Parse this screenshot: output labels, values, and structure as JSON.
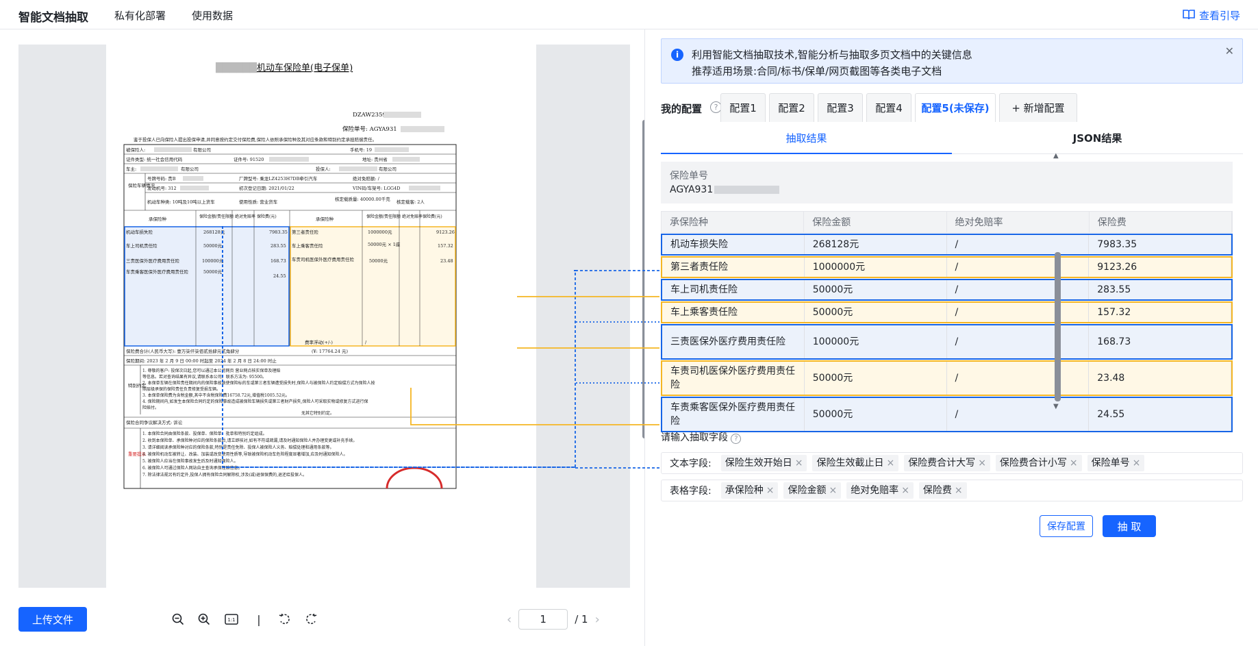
{
  "header": {
    "brand": "智能文档抽取",
    "nav": [
      "私有化部署",
      "使用数据"
    ],
    "guide": "查看引导"
  },
  "document": {
    "title": "机动车保险单(电子保单)",
    "policy_code": "DZAW2359",
    "policy_no": "保险单号: AGYA931",
    "notice_line": "鉴于投保人已向保险人提出投保申请,并同意按约定交付保险费,保险人依照承保险种及其对应条款和特别约定承担赔偿责任。",
    "insured": "被保险人:",
    "insured_suffix": "有限公司",
    "phone": "手机号: 19",
    "id_type": "证件类型: 统一社会信用代码",
    "id_no": "证件号: 91520",
    "addr": "地址: 贵州省",
    "owner": "车主:",
    "owner_suffix": "有限公司",
    "applicant": "投保人:",
    "applicant_suffix": "有限公司",
    "veh_label": "保险车辆情况",
    "plate": "号牌号码: 贵B",
    "model": "厂牌型号: 乘龙LZ4253H7DB牵引汽车",
    "deduct": "绝对免赔额: /",
    "engine": "发动机号: 312",
    "reg_date": "初次登记日期: 2021/01/22",
    "vin": "VIN码/车架号: LGG4D",
    "vtype": "机动车种类: 10吨及10吨以上货车",
    "use": "使用性质: 营业货车",
    "load": "核定载质量: 40000.00千克",
    "seats": "核定载客: 2人",
    "cols": [
      "承保险种",
      "保险金额/责任限额",
      "绝对免赔率",
      "保险费(元)"
    ],
    "left_items": [
      [
        "机动车损失险",
        "268128元",
        "7983.35"
      ],
      [
        "车上司机责任险",
        "50000元",
        "283.55"
      ],
      [
        "三责医保外医疗费用责任险",
        "100000元",
        "168.73"
      ],
      [
        "车责乘客医保外医疗费用责任险",
        "50000元",
        "24.55"
      ]
    ],
    "right_items": [
      [
        "第三者责任险",
        "1000000元",
        "9123.26"
      ],
      [
        "车上乘客责任险",
        "50000元 × 1座",
        "157.32"
      ],
      [
        "车责司机医保外医疗费用责任险",
        "50000元",
        "23.48"
      ]
    ],
    "float_row": "费率浮动(+/-)",
    "float_val": "/",
    "total": "保险费合计(人民币大写): 壹万柒仟柒佰贰拾肆元贰角肆分",
    "total_num": "(¥: 17764.24 元)",
    "period": "保险期间: 2023 年 2 月 9 日 00:00 时起至 2024 年 2 月 8 日 24:00 时止",
    "special_label": "特别约定",
    "special": [
      "1. 尊敬的客户: 投保次日起,您可以通过本公司网页                    营业网点核实保单及理赔",
      "等信息。若对查询结果有异议,请联系本公司。联系方法为: 95500。",
      "2. 本保单车辆在保险责任期间内的保险事故致使保险标的车或第三者车辆遭受损失时,保险人与被保险人约定赔偿方式为保险人按",
      "照层级承保的保险责任负责修复受损车辆。",
      "3. 本保单保险费为含税金额,其中不含税保险费16758.72元,增值税1005.52元。",
      "4. 保险期间内,如发生本保险合同约定的保险事故造成被保险车辆损失或第三者财产损失,保险人可采取实物或修复方式进行保",
      "险赔付。"
    ],
    "special_end": "无其它特别约定。",
    "dispute": "保险合同争议解决方式: 诉讼",
    "tips_label": "重要提示",
    "tips": [
      "1. 本保险合同由保险条款、投保单、保险单、批单和特别约定组成。",
      "2. 收到本保险单、承保险种对应的保险条款后,请立即核对,如有不符或疏漏,请及时通知保险人并办理变更或补充手续。",
      "3. 请详细阅读承保险种对应的保险条款,特别是责任免除、投保人被保险人义务、赔偿处理和通用条款等。",
      "4. 被保险机动车被转让、改装、加装或改变使用性质等,导致被保险机动车危险程度显著增加,应及时通知保险人。",
      "5. 被保险人应当在保险事故发生后及时通知保险人。",
      "6. 被保险人可通过保险人网站自主查询承保理赔信息。",
      "7. 除法律法规另有约定外,投保人拥有保险合同解除权,涉及(减)退保保费的,退还给投保人。"
    ]
  },
  "toolbar": {
    "upload": "上传文件",
    "page_current": "1",
    "page_total": "/ 1",
    "sep": "|",
    "ratio": "1:1"
  },
  "notice": {
    "line1": "利用智能文档抽取技术,智能分析与抽取多页文档中的关键信息",
    "line2": "推荐适用场景:合同/标书/保单/网页截图等各类电子文档"
  },
  "config": {
    "label": "我的配置",
    "tabs": [
      "配置1",
      "配置2",
      "配置3",
      "配置4",
      "配置5(未保存)",
      "+ 新增配置"
    ],
    "active": 4
  },
  "result_tabs": [
    "抽取结果",
    "JSON结果"
  ],
  "result": {
    "field_label": "保险单号",
    "field_value": "AGYA931",
    "headers": [
      "承保险种",
      "保险金额",
      "绝对免赔率",
      "保险费"
    ],
    "rows": [
      {
        "name": "机动车损失险",
        "amount": "268128元",
        "rate": "/",
        "fee": "7983.35",
        "color": "blue"
      },
      {
        "name": "第三者责任险",
        "amount": "1000000元",
        "rate": "/",
        "fee": "9123.26",
        "color": "yellow"
      },
      {
        "name": "车上司机责任险",
        "amount": "50000元",
        "rate": "/",
        "fee": "283.55",
        "color": "blue"
      },
      {
        "name": "车上乘客责任险",
        "amount": "50000元",
        "rate": "/",
        "fee": "157.32",
        "color": "yellow"
      },
      {
        "name": "三责医保外医疗费用责任险",
        "amount": "100000元",
        "rate": "/",
        "fee": "168.73",
        "color": "blue"
      },
      {
        "name": "车责司机医保外医疗费用责任险",
        "amount": "50000元",
        "rate": "/",
        "fee": "23.48",
        "color": "yellow"
      },
      {
        "name": "车责乘客医保外医疗费用责任险",
        "amount": "50000元",
        "rate": "/",
        "fee": "24.55",
        "color": "blue"
      }
    ]
  },
  "fields": {
    "input_label": "请输入抽取字段",
    "text_label": "文本字段:",
    "text_tags": [
      "保险生效开始日",
      "保险生效截止日",
      "保险费合计大写",
      "保险费合计小写",
      "保险单号"
    ],
    "table_label": "表格字段:",
    "table_tags": [
      "承保险种",
      "保险金额",
      "绝对免赔率",
      "保险费"
    ],
    "remove": "×"
  },
  "buttons": {
    "save": "保存配置",
    "extract": "抽 取"
  },
  "colors": {
    "primary": "#1664ff",
    "blue_border": "#1664e6",
    "yellow_border": "#f5b623"
  }
}
